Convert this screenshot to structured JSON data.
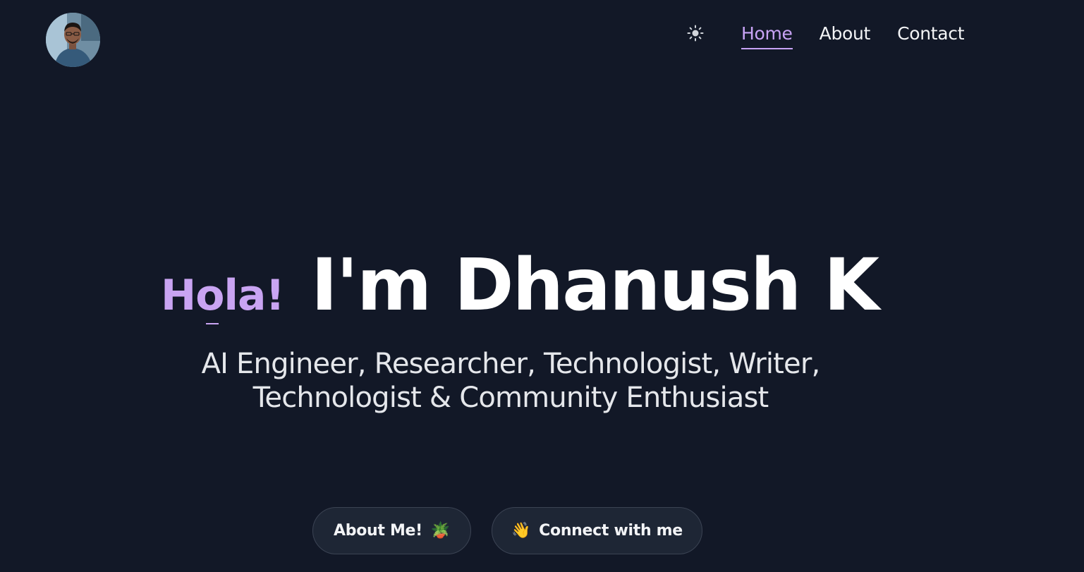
{
  "header": {
    "nav": {
      "items": [
        {
          "label": "Home",
          "active": true
        },
        {
          "label": "About",
          "active": false
        },
        {
          "label": "Contact",
          "active": false
        }
      ]
    },
    "theme_icon": "sun-icon"
  },
  "hero": {
    "greeting": "Hola!",
    "title": "I'm Dhanush K",
    "subtitle_line1": "AI Engineer, Researcher, Technologist, Writer,",
    "subtitle_line2": "Technologist & Community Enthusiast"
  },
  "buttons": {
    "about_label": "About Me!",
    "about_emoji": "🪴",
    "connect_label": "Connect with me",
    "connect_emoji": "👋"
  },
  "colors": {
    "background": "#121827",
    "accent": "#c8a3f5",
    "button_bg": "#1e2635"
  }
}
